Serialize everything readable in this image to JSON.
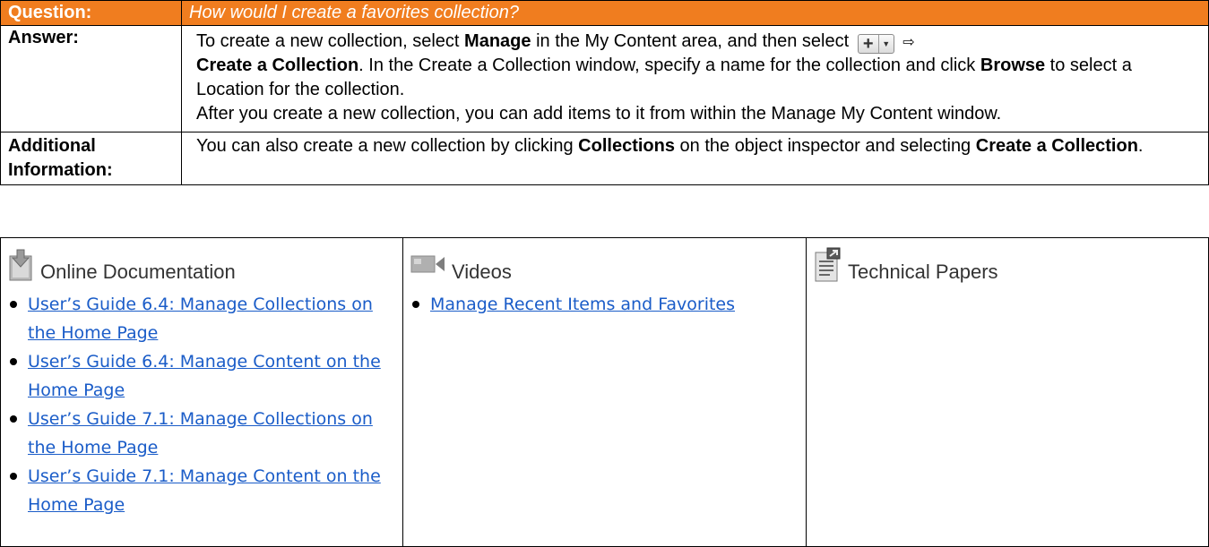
{
  "question": {
    "label": "Question:",
    "text": "How would I create a favorites collection?"
  },
  "answer": {
    "label": "Answer:",
    "p1_a": "To create a new collection, select ",
    "p1_manage": "Manage",
    "p1_b": " in the My Content area, and then select ",
    "p1_create": "Create a Collection",
    "p1_c": ".  In the Create a Collection window, specify a name for the collection and click ",
    "p1_browse": "Browse",
    "p1_d": " to select a Location for the collection.",
    "p2": "After you create a new collection, you can add items to it from within the Manage My Content window."
  },
  "additional": {
    "label": "Additional Information:",
    "a": "You can also create a new collection by clicking ",
    "collections": "Collections",
    "b": " on the object inspector and selecting ",
    "create": "Create a Collection",
    "c": "."
  },
  "resources": {
    "docs": {
      "title": "Online Documentation",
      "icon": "document-download-icon",
      "links": [
        "User’s Guide 6.4: Manage Collections on the Home Page",
        "User’s Guide 6.4: Manage Content on the Home Page",
        "User’s Guide 7.1: Manage Collections on the Home Page",
        "User’s Guide 7.1: Manage Content on the Home Page"
      ]
    },
    "videos": {
      "title": "Videos",
      "icon": "video-camera-icon",
      "links": [
        "Manage Recent Items and Favorites"
      ]
    },
    "papers": {
      "title": "Technical Papers",
      "icon": "technical-paper-icon",
      "links": []
    }
  },
  "colors": {
    "header_orange": "#f07d1f",
    "link_blue": "#1a5cc8"
  }
}
